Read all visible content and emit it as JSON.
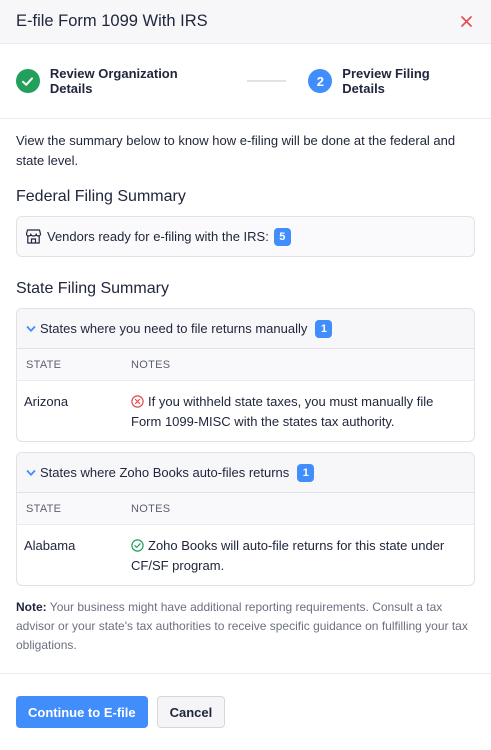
{
  "header": {
    "title": "E-file Form 1099 With IRS",
    "close_icon": "close-icon"
  },
  "stepper": {
    "steps": [
      {
        "label": "Review Organization Details",
        "status": "complete",
        "icon": "check-circle-icon"
      },
      {
        "label": "Preview Filing Details",
        "status": "active",
        "number": "2"
      }
    ]
  },
  "intro": "View the summary below to know how e-filing will be done at the federal and state level.",
  "federal": {
    "title": "Federal Filing Summary",
    "icon": "vendor-store-icon",
    "text": "Vendors ready for e-filing with the IRS:",
    "count": "5"
  },
  "state": {
    "title": "State Filing Summary",
    "columns": {
      "state": "STATE",
      "notes": "NOTES"
    },
    "manual": {
      "heading": "States where you need to file returns manually",
      "count": "1",
      "rows": [
        {
          "state": "Arizona",
          "note": "If you withheld state taxes, you must manually file Form 1099-MISC with the states tax authority.",
          "icon": "error-circle-icon"
        }
      ]
    },
    "auto": {
      "heading": "States where Zoho Books auto-files returns",
      "count": "1",
      "rows": [
        {
          "state": "Alabama",
          "note": "Zoho Books will auto-file returns for this state under CF/SF program.",
          "icon": "check-circle-outline-icon"
        }
      ]
    }
  },
  "note": {
    "label": "Note:",
    "text": "Your business might have additional reporting requirements. Consult a tax advisor or your state's tax authorities to receive specific guidance on fulfilling your tax obligations."
  },
  "footer": {
    "primary_label": "Continue to E-file",
    "secondary_label": "Cancel"
  },
  "colors": {
    "accent": "#408dfb",
    "success": "#219f5b",
    "error": "#e54b4b",
    "close": "#e54b4b"
  }
}
